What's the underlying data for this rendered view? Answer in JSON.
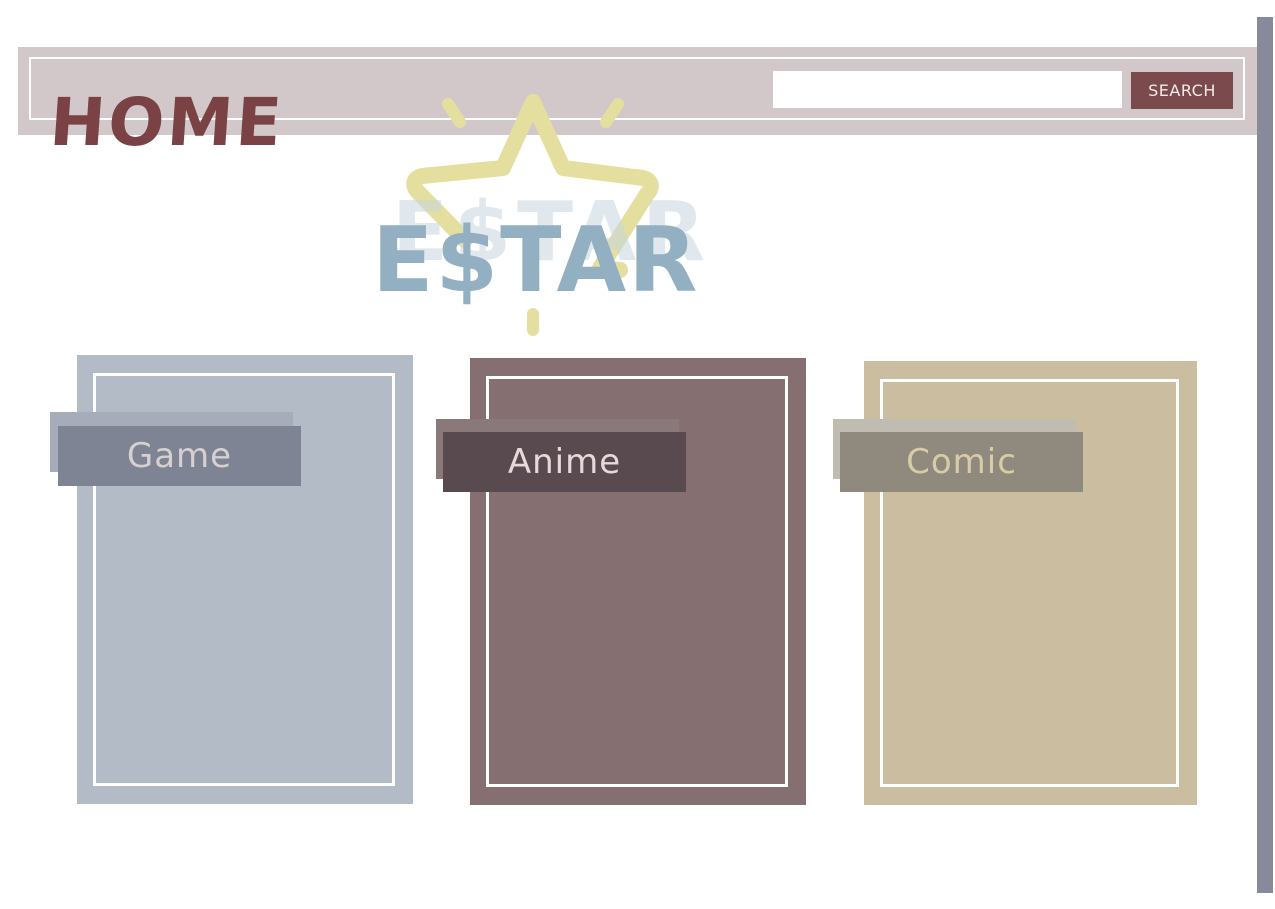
{
  "header": {
    "title": "HOME",
    "search": {
      "value": "",
      "placeholder": "",
      "button_label": "SEARCH"
    }
  },
  "logo": {
    "text": "E$TAR",
    "icon": "star-icon"
  },
  "categories": [
    {
      "label": "Game",
      "color": "#b3bbc6"
    },
    {
      "label": "Anime",
      "color": "#866f71"
    },
    {
      "label": "Comic",
      "color": "#cbbd9f"
    }
  ],
  "colors": {
    "header_bar": "#d2c8c9",
    "accent": "#7a4a4c",
    "logo_text": "#93b0c3",
    "logo_star": "#e4df9e",
    "scrollbar": "#868a9b"
  }
}
